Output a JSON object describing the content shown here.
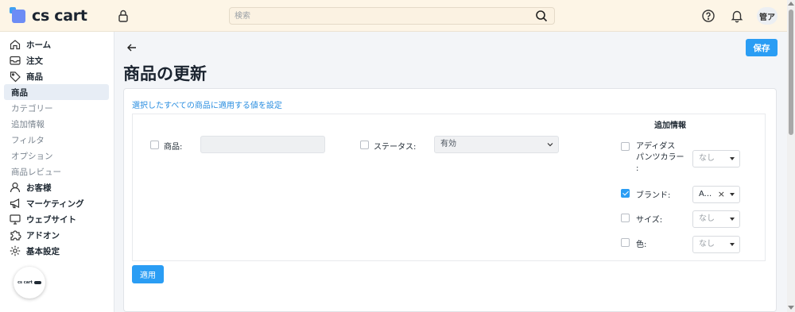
{
  "header": {
    "logo_text": "cs cart",
    "search_placeholder": "検索",
    "avatar_text": "管ア",
    "icons": [
      "lock-icon",
      "search-icon",
      "help-icon",
      "bell-icon"
    ]
  },
  "sidebar": {
    "items": [
      {
        "label": "ホーム",
        "icon": "home-icon",
        "kind": "main"
      },
      {
        "label": "注文",
        "icon": "inbox-icon",
        "kind": "main"
      },
      {
        "label": "商品",
        "icon": "tag-icon",
        "kind": "main"
      },
      {
        "label": "商品",
        "kind": "active"
      },
      {
        "label": "カテゴリー",
        "kind": "sub"
      },
      {
        "label": "追加情報",
        "kind": "sub"
      },
      {
        "label": "フィルタ",
        "kind": "sub"
      },
      {
        "label": "オプション",
        "kind": "sub"
      },
      {
        "label": "商品レビュー",
        "kind": "sub"
      },
      {
        "label": "お客様",
        "icon": "user-icon",
        "kind": "main"
      },
      {
        "label": "マーケティング",
        "icon": "megaphone-icon",
        "kind": "main"
      },
      {
        "label": "ウェブサイト",
        "icon": "monitor-icon",
        "kind": "main"
      },
      {
        "label": "アドオン",
        "icon": "puzzle-icon",
        "kind": "main"
      },
      {
        "label": "基本設定",
        "icon": "gear-icon",
        "kind": "main"
      }
    ],
    "badge_text": "cs cart"
  },
  "main": {
    "title": "商品の更新",
    "save_label": "保存",
    "card_link": "選択したすべての商品に適用する値を設定",
    "product_label": "商品:",
    "status_label": "ステータス:",
    "status_value": "有効",
    "extra_title": "追加情報",
    "features": [
      {
        "label": "アディダス\nパンツカラー\n:",
        "value": "なし",
        "checked": false
      },
      {
        "label": "ブランド:",
        "value": "A...",
        "checked": true
      },
      {
        "label": "サイズ:",
        "value": "なし",
        "checked": false
      },
      {
        "label": "色:",
        "value": "なし",
        "checked": false
      }
    ],
    "apply_label": "適用"
  },
  "colors": {
    "accent": "#2a9df4",
    "header_bg": "#fdf5e6",
    "link": "#2a8ee0"
  }
}
